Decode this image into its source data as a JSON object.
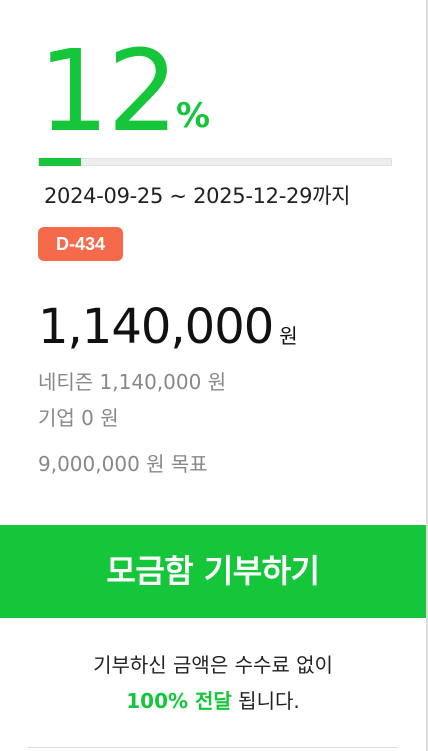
{
  "progress": {
    "percent_value": "12",
    "percent_sign": "%",
    "fraction": 0.12,
    "color": "#15c63a"
  },
  "period": {
    "text": "2024-09-25 ~ 2025-12-29까지"
  },
  "dday_badge": {
    "label": "D-434",
    "color": "#f46a4a"
  },
  "raised": {
    "amount": "1,140,000",
    "unit": "원"
  },
  "breakdown": {
    "citizen": "네티즌 1,140,000 원",
    "company": "기업 0 원"
  },
  "goal": {
    "text": "9,000,000 원 목표"
  },
  "donate_button": {
    "label": "모금함 기부하기"
  },
  "notice": {
    "line1": "기부하신 금액은 수수료 없이",
    "highlight": "100% 전달",
    "line2_suffix": " 됩니다."
  }
}
